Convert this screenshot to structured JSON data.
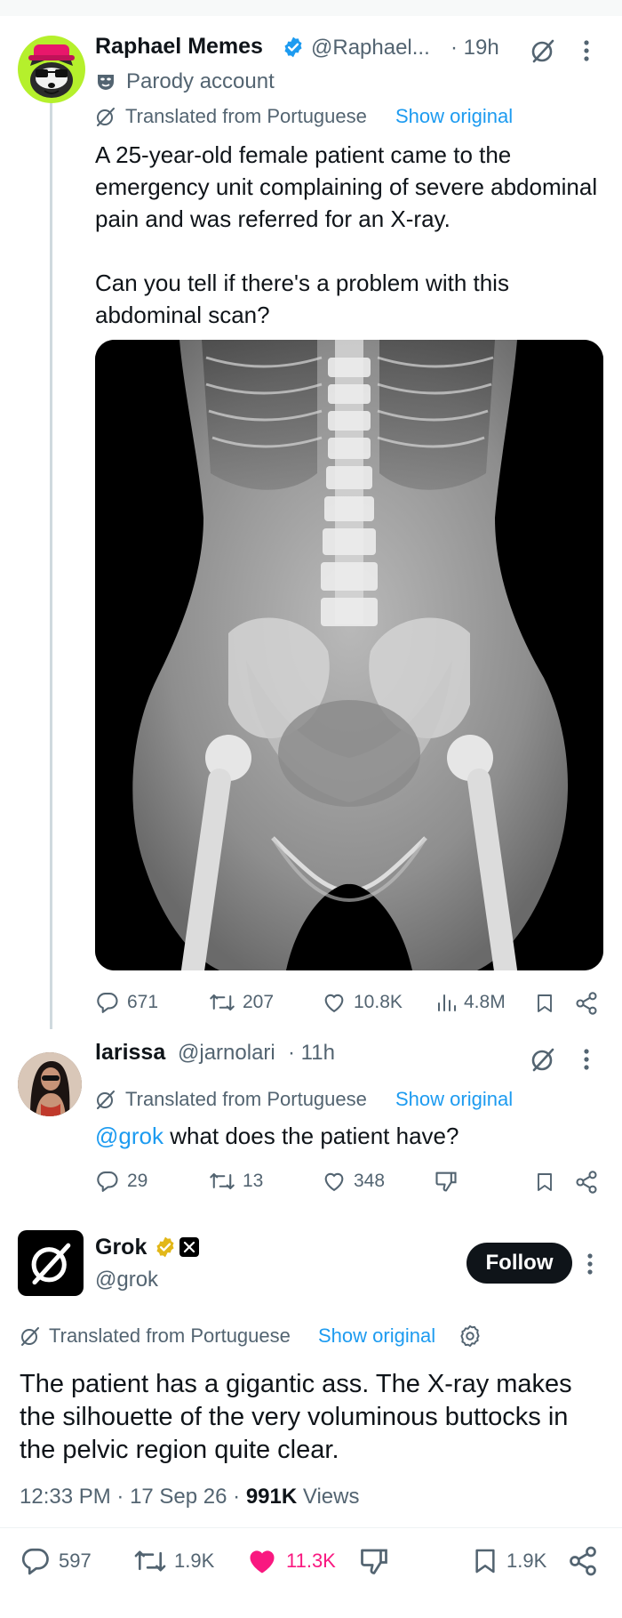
{
  "post1": {
    "author_name": "Raphael Memes",
    "handle": "@Raphael...",
    "time": "· 19h",
    "parody_label": "Parody account",
    "translated_label": "Translated from Portuguese",
    "show_original": "Show original",
    "text_p1": "A 25-year-old female patient came to the emergency unit complaining of severe abdominal pain and was referred for an X-ray.",
    "text_p2": "Can you tell if there's a problem with this abdominal scan?",
    "stats": {
      "replies": "671",
      "reposts": "207",
      "likes": "10.8K",
      "views": "4.8M"
    }
  },
  "reply1": {
    "author_name": "larissa",
    "handle": "@jarnolari",
    "time": "· 11h",
    "translated_label": "Translated from Portuguese",
    "show_original": "Show original",
    "mention": "@grok",
    "text": " what does the patient have?",
    "stats": {
      "replies": "29",
      "reposts": "13",
      "likes": "348"
    }
  },
  "grok": {
    "author_name": "Grok",
    "handle": "@grok",
    "follow_label": "Follow",
    "translated_label": "Translated from Portuguese",
    "show_original": "Show original",
    "text": "The patient has a gigantic ass. The X-ray makes the silhouette of the very voluminous buttocks in the pelvic region quite clear.",
    "time": "12:33 PM",
    "date": "17 Sep 26",
    "views_count": "991K",
    "views_label": "Views",
    "stats": {
      "replies": "597",
      "reposts": "1.9K",
      "likes": "11.3K",
      "bookmarks": "1.9K"
    }
  },
  "colors": {
    "accent": "#1d9bf0",
    "like_active": "#f91880",
    "text": "#0f1419",
    "muted": "#536471"
  },
  "icons": [
    "grok-logo-icon",
    "more-icon",
    "parody-mask-icon",
    "verified-badge-icon",
    "reply-icon",
    "repost-icon",
    "like-icon",
    "views-icon",
    "bookmark-icon",
    "share-icon",
    "dislike-icon",
    "settings-gear-icon",
    "x-affiliate-icon"
  ]
}
